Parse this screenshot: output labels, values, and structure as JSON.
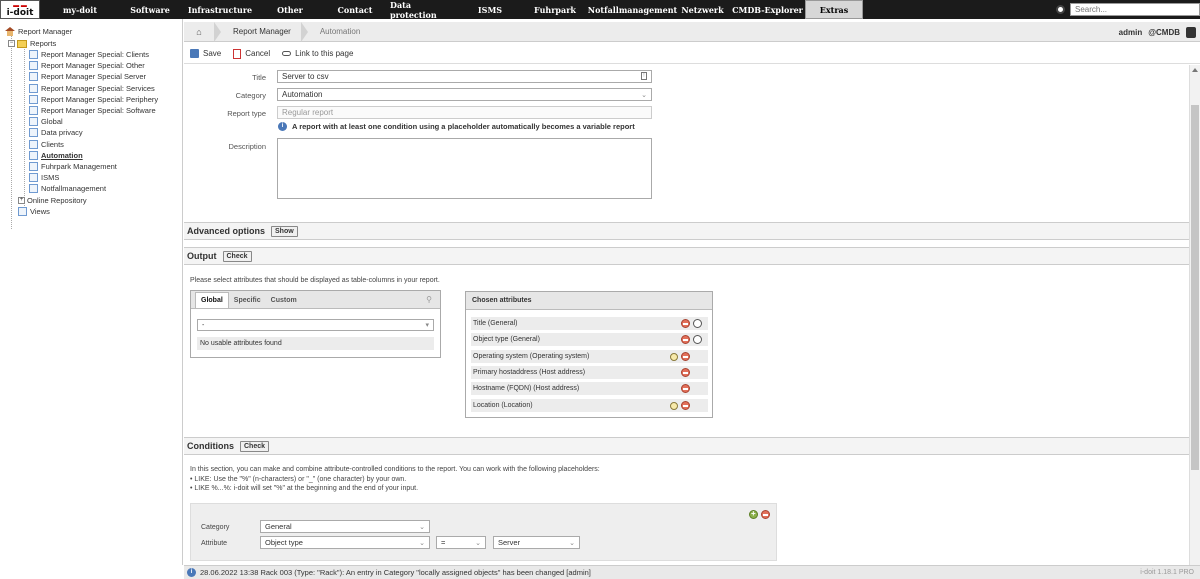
{
  "nav": {
    "logo_top": "i-doit",
    "logo_bottom": "i-doit",
    "items": [
      "my-doit",
      "Software",
      "Infrastructure",
      "Other",
      "Contact",
      "Data protection",
      "ISMS",
      "Fuhrpark",
      "Notfallmanagement",
      "Netzwerk",
      "CMDB-Explorer",
      "Extras"
    ],
    "active": "Extras",
    "search_placeholder": "Search..."
  },
  "sidebar": {
    "root": "Report Manager",
    "reports_label": "Reports",
    "items": [
      "Report Manager Special: Clients",
      "Report Manager Special: Other",
      "Report Manager Special Server",
      "Report Manager Special: Services",
      "Report Manager Special: Periphery",
      "Report Manager Special: Software",
      "Global",
      "Data privacy",
      "Clients",
      "Automation",
      "Fuhrpark Management",
      "ISMS",
      "Notfallmanagement"
    ],
    "active_item": "Automation",
    "online_repository": "Online Repository",
    "views": "Views"
  },
  "breadcrumb": {
    "items": [
      "Report Manager",
      "Automation"
    ],
    "user": "admin",
    "tenant": "@CMDB"
  },
  "toolbar": {
    "save": "Save",
    "cancel": "Cancel",
    "link": "Link to this page"
  },
  "form": {
    "title_label": "Title",
    "title_value": "Server to csv",
    "category_label": "Category",
    "category_value": "Automation",
    "report_type_label": "Report type",
    "report_type_value": "Regular report",
    "info_text": "A report with at least one condition using a placeholder automatically becomes a variable report",
    "description_label": "Description"
  },
  "advanced": {
    "title": "Advanced options",
    "button": "Show"
  },
  "output": {
    "title": "Output",
    "button": "Check",
    "hint": "Please select attributes that should be displayed as table-columns in your report.",
    "tabs": [
      "Global",
      "Specific",
      "Custom"
    ],
    "select_value": "-",
    "empty_text": "No usable attributes found",
    "chosen_title": "Chosen attributes",
    "chosen": [
      {
        "label": "Title (General)",
        "search": false,
        "radio": true
      },
      {
        "label": "Object type (General)",
        "search": false,
        "radio": true
      },
      {
        "label": "Operating system (Operating system)",
        "search": true,
        "radio": false
      },
      {
        "label": "Primary hostaddress (Host address)",
        "search": false,
        "radio": false
      },
      {
        "label": "Hostname (FQDN) (Host address)",
        "search": false,
        "radio": false
      },
      {
        "label": "Location (Location)",
        "search": true,
        "radio": false
      }
    ]
  },
  "conditions": {
    "title": "Conditions",
    "button": "Check",
    "intro": "In this section, you can make and combine attribute-controlled conditions to the report. You can work with the following placeholders:",
    "bullet1": "• LIKE: Use the \"%\" (n-characters) or \"_\" (one character) by your own.",
    "bullet2": "• LIKE %...%: i-doit will set \"%\" at the beginning and the end of your input.",
    "category_label": "Category",
    "category_value": "General",
    "attribute_label": "Attribute",
    "attribute_value": "Object type",
    "operator_value": "=",
    "compare_value": "Server"
  },
  "status": {
    "message": "28.06.2022 13:38 Rack 003 (Type: \"Rack\"): An entry in Category \"locally assigned objects\" has been changed [admin]",
    "version": "i-doit 1.18.1 PRO"
  }
}
